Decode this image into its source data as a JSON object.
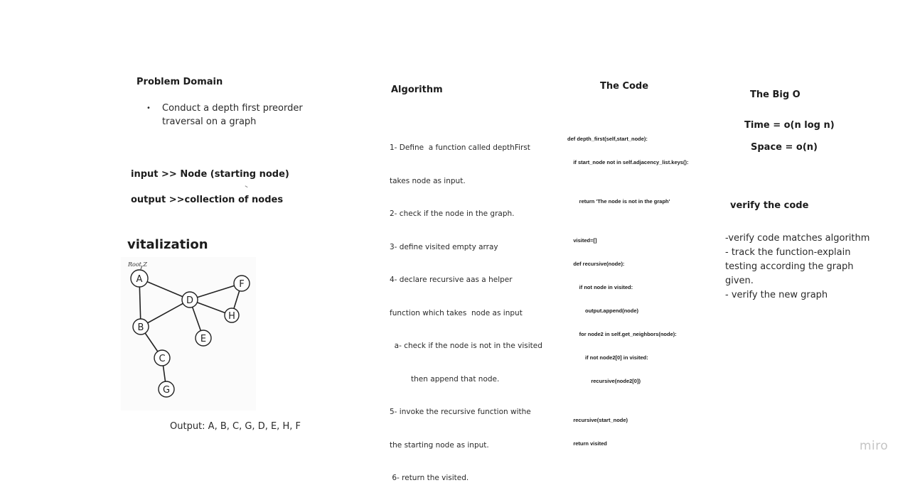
{
  "problem_domain": {
    "title": "Problem Domain",
    "bullets": [
      "Conduct a depth first preorder traversal on a graph"
    ]
  },
  "io": {
    "input": "input >> Node (starting node)",
    "output": "output >>collection of nodes"
  },
  "visualization": {
    "title": "vitalization",
    "root_label": "Root Z",
    "nodes": [
      "A",
      "B",
      "C",
      "D",
      "E",
      "F",
      "G",
      "H"
    ],
    "output_text": "Output: A, B, C, G, D, E, H, F"
  },
  "algorithm": {
    "title": "Algorithm",
    "lines": [
      "1- Define  a function called depthFirst",
      "takes node as input.",
      "2- check if the node in the graph.",
      "3- define visited empty array",
      "4- declare recursive aas a helper",
      "function which takes  node as input",
      "  a- check if the node is not in the visited",
      "         then append that node.",
      "5- invoke the recursive function withe",
      "the starting node as input.",
      " 6- return the visited."
    ]
  },
  "code": {
    "title": "The Code",
    "lines": [
      "def depth_first(self,start_node):",
      "    if start_node not in self.adjacency_list.keys():",
      "",
      "        return 'The node is not in the graph'",
      "",
      "    visited=[]",
      "    def recursive(node):",
      "        if not node in visited:",
      "            output.append(node)",
      "        for node2 in self.get_neighbors(node):",
      "            if not node2[0] in visited:",
      "                recursive(node2[0])",
      "",
      "    recursive(start_node)",
      "    return visited"
    ]
  },
  "big_o": {
    "title": "The Big O",
    "time": "Time = o(n log n)",
    "space": "Space = o(n)"
  },
  "verify": {
    "title": "verify the code",
    "lines": [
      "-verify code matches algorithm",
      "- track the function-explain",
      "testing according the graph",
      "given.",
      "- verify the new graph"
    ]
  },
  "watermark": "miro"
}
